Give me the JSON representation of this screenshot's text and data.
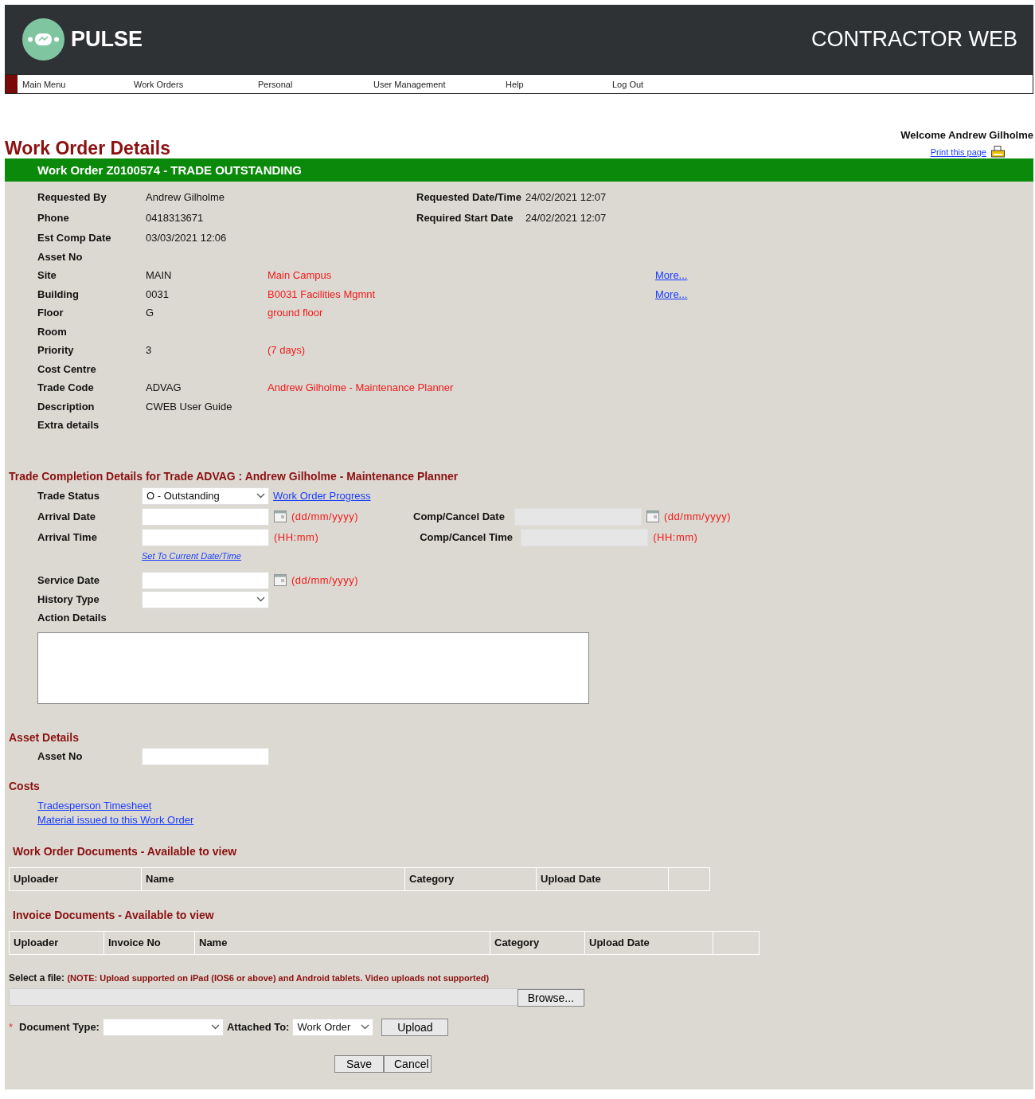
{
  "header": {
    "logo_text": "PULSE",
    "app_title": "CONTRACTOR WEB"
  },
  "nav": [
    "Main Menu",
    "Work Orders",
    "Personal",
    "User Management",
    "Help",
    "Log Out"
  ],
  "welcome": "Welcome Andrew Gilholme",
  "print_link": "Print this page",
  "page_title": "Work Order Details",
  "banner": "Work Order Z0100574 - TRADE OUTSTANDING",
  "details": [
    {
      "label": "Requested By",
      "value": "Andrew Gilholme",
      "aside_label": "Requested Date/Time",
      "aside_value": "24/02/2021 12:07"
    },
    {
      "label": "Phone",
      "value": "0418313671",
      "aside_label": "Required Start Date",
      "aside_value": "24/02/2021 12:07"
    },
    {
      "label": "Est Comp Date",
      "value": "03/03/2021 12:06"
    },
    {
      "label": "Asset No"
    },
    {
      "label": "Site",
      "value": "MAIN",
      "note": "Main Campus",
      "link": "More..."
    },
    {
      "label": "Building",
      "value": "0031",
      "note": "B0031 Facilities Mgmnt",
      "link": "More..."
    },
    {
      "label": "Floor",
      "value": "G",
      "note": "ground floor"
    },
    {
      "label": "Room"
    },
    {
      "label": "Priority",
      "value": "3",
      "note": "(7 days)"
    },
    {
      "label": "Cost Centre"
    },
    {
      "label": "Trade Code",
      "value": "ADVAG",
      "note": "Andrew Gilholme - Maintenance Planner"
    },
    {
      "label": "Description",
      "value": "CWEB User Guide"
    },
    {
      "label": "Extra details"
    }
  ],
  "trade": {
    "heading": "Trade Completion Details for Trade ADVAG : Andrew Gilholme - Maintenance Planner",
    "status_label": "Trade Status",
    "status_value": "O - Outstanding",
    "progress_link": "Work Order Progress",
    "arrival_date": {
      "label": "Arrival Date",
      "hint": "(dd/mm/yyyy)"
    },
    "arrival_time": {
      "label": "Arrival Time",
      "hint": "(HH:mm)"
    },
    "comp_date": {
      "label": "Comp/Cancel Date",
      "hint": "(dd/mm/yyyy)",
      "disabled": true
    },
    "comp_time": {
      "label": "Comp/Cancel Time",
      "hint": "(HH:mm)",
      "disabled": true
    },
    "set_current_link": "Set To Current Date/Time",
    "service_date": {
      "label": "Service Date",
      "hint": "(dd/mm/yyyy)"
    },
    "history_label": "History Type",
    "action_label": "Action Details"
  },
  "asset": {
    "heading": "Asset Details",
    "label": "Asset No"
  },
  "costs": {
    "heading": "Costs",
    "links": [
      "Tradesperson Timesheet",
      "Material issued to this Work Order"
    ]
  },
  "wo_documents": {
    "heading": "Work Order Documents - Available to view",
    "columns": [
      "Uploader",
      "Name",
      "Category",
      "Upload Date",
      ""
    ]
  },
  "invoice_documents": {
    "heading": "Invoice Documents - Available to view",
    "columns": [
      "Uploader",
      "Invoice No",
      "Name",
      "Category",
      "Upload Date",
      ""
    ]
  },
  "upload": {
    "label": "Select a file:",
    "note": "(NOTE: Upload supported on iPad (IOS6 or above) and Android tablets. Video uploads not supported)",
    "browse": "Browse...",
    "required_mark": "*",
    "doc_type_label": "Document Type:",
    "attached_label": "Attached To:",
    "attached_value": "Work Order",
    "upload_button": "Upload"
  },
  "actions": [
    "Save",
    "Cancel"
  ]
}
